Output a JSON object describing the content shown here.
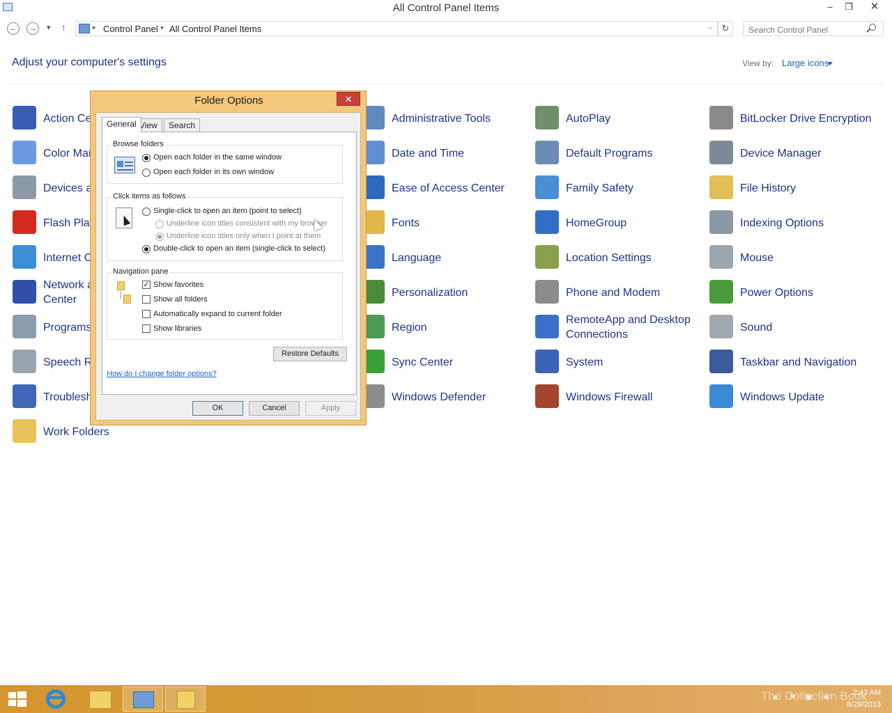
{
  "window": {
    "title": "All Control Panel Items",
    "minimize": "–",
    "restore": "❐",
    "close": "✕"
  },
  "address": {
    "back": "←",
    "forward": "→",
    "recent": "▾",
    "up": "↑",
    "crumbs": [
      "Control Panel",
      "All Control Panel Items"
    ],
    "dropdown": "⌵",
    "refresh": "↻",
    "search_placeholder": "Search Control Panel"
  },
  "header": {
    "title": "Adjust your computer's settings",
    "view_by_label": "View by:",
    "view_by_value": "Large icons"
  },
  "items": [
    {
      "label": "Action Center",
      "icon": "flag-icon",
      "color": "#3a5db4"
    },
    {
      "label": "Color Management",
      "icon": "color-monitor-icon",
      "color": "#6a9be0"
    },
    {
      "label": "Devices and Printers",
      "icon": "printer-icon",
      "color": "#8c9aa8"
    },
    {
      "label": "Flash Player",
      "icon": "flash-icon",
      "color": "#d42a1e"
    },
    {
      "label": "Internet Options",
      "icon": "globe-icon",
      "color": "#3b8ed6"
    },
    {
      "label": "Network and Sharing Center",
      "icon": "network-icon",
      "color": "#2f4fa8"
    },
    {
      "label": "Programs and Features",
      "icon": "programs-icon",
      "color": "#8a9cae"
    },
    {
      "label": "Speech Recognition",
      "icon": "microphone-icon",
      "color": "#9aa4ae"
    },
    {
      "label": "Troubleshooting",
      "icon": "troubleshoot-icon",
      "color": "#3f66b8"
    },
    {
      "label": "Work Folders",
      "icon": "work-folder-icon",
      "color": "#e8c25a"
    },
    {
      "label": "Administrative Tools",
      "icon": "admin-tools-icon",
      "color": "#5f8bbf"
    },
    {
      "label": "Date and Time",
      "icon": "calendar-icon",
      "color": "#5b90d2"
    },
    {
      "label": "Ease of Access Center",
      "icon": "ease-of-access-icon",
      "color": "#2d6bc0"
    },
    {
      "label": "Fonts",
      "icon": "fonts-icon",
      "color": "#e0b84a"
    },
    {
      "label": "Language",
      "icon": "language-icon",
      "color": "#3a74c8"
    },
    {
      "label": "Personalization",
      "icon": "personalization-icon",
      "color": "#4b8a3a"
    },
    {
      "label": "Region",
      "icon": "region-icon",
      "color": "#4a9a5a"
    },
    {
      "label": "Sync Center",
      "icon": "sync-icon",
      "color": "#3aa03a"
    },
    {
      "label": "Windows Defender",
      "icon": "defender-icon",
      "color": "#8d8d8d"
    },
    {
      "label": "AutoPlay",
      "icon": "autoplay-icon",
      "color": "#6f8f6a"
    },
    {
      "label": "Default Programs",
      "icon": "default-programs-icon",
      "color": "#6b8cb3"
    },
    {
      "label": "Family Safety",
      "icon": "family-safety-icon",
      "color": "#4a8fd6"
    },
    {
      "label": "HomeGroup",
      "icon": "homegroup-icon",
      "color": "#2f6fc4"
    },
    {
      "label": "Location Settings",
      "icon": "location-icon",
      "color": "#8aa04a"
    },
    {
      "label": "Phone and Modem",
      "icon": "phone-icon",
      "color": "#8c8c8c"
    },
    {
      "label": "RemoteApp and Desktop Connections",
      "icon": "remoteapp-icon",
      "color": "#3b70c8"
    },
    {
      "label": "System",
      "icon": "system-icon",
      "color": "#3a64b8"
    },
    {
      "label": "Windows Firewall",
      "icon": "firewall-icon",
      "color": "#a4452e"
    },
    {
      "label": "BitLocker Drive Encryption",
      "icon": "bitlocker-icon",
      "color": "#8a8a8a"
    },
    {
      "label": "Device Manager",
      "icon": "device-manager-icon",
      "color": "#7d8a96"
    },
    {
      "label": "File History",
      "icon": "file-history-icon",
      "color": "#e2be58"
    },
    {
      "label": "Indexing Options",
      "icon": "indexing-icon",
      "color": "#8a98a8"
    },
    {
      "label": "Mouse",
      "icon": "mouse-icon",
      "color": "#9ea6ae"
    },
    {
      "label": "Power Options",
      "icon": "power-icon",
      "color": "#4a9a3a"
    },
    {
      "label": "Sound",
      "icon": "speaker-icon",
      "color": "#a0a8b0"
    },
    {
      "label": "Taskbar and Navigation",
      "icon": "taskbar-icon",
      "color": "#3a5c9a"
    },
    {
      "label": "Windows Update",
      "icon": "windows-update-icon",
      "color": "#3a8ad6"
    }
  ],
  "dialog": {
    "title": "Folder Options",
    "close": "✕",
    "tabs": [
      "General",
      "View",
      "Search"
    ],
    "browse": {
      "label": "Browse folders",
      "opt1": "Open each folder in the same window",
      "opt2": "Open each folder in its own window"
    },
    "click": {
      "label": "Click items as follows",
      "single": "Single-click to open an item (point to select)",
      "underline1": "Underline icon titles consistent with my browser",
      "underline2": "Underline icon titles only when I point at them",
      "double": "Double-click to open an item (single-click to select)"
    },
    "nav": {
      "label": "Navigation pane",
      "favorites": "Show favorites",
      "all_folders": "Show all folders",
      "expand": "Automatically expand to current folder",
      "libraries": "Show libraries",
      "check_mark": "✓"
    },
    "restore": "Restore Defaults",
    "help_link": "How do I change folder options?",
    "ok": "OK",
    "cancel": "Cancel",
    "apply": "Apply"
  },
  "taskbar": {
    "time": "2:43 AM",
    "date": "8/29/2013",
    "watermark": "The Collection Book"
  }
}
